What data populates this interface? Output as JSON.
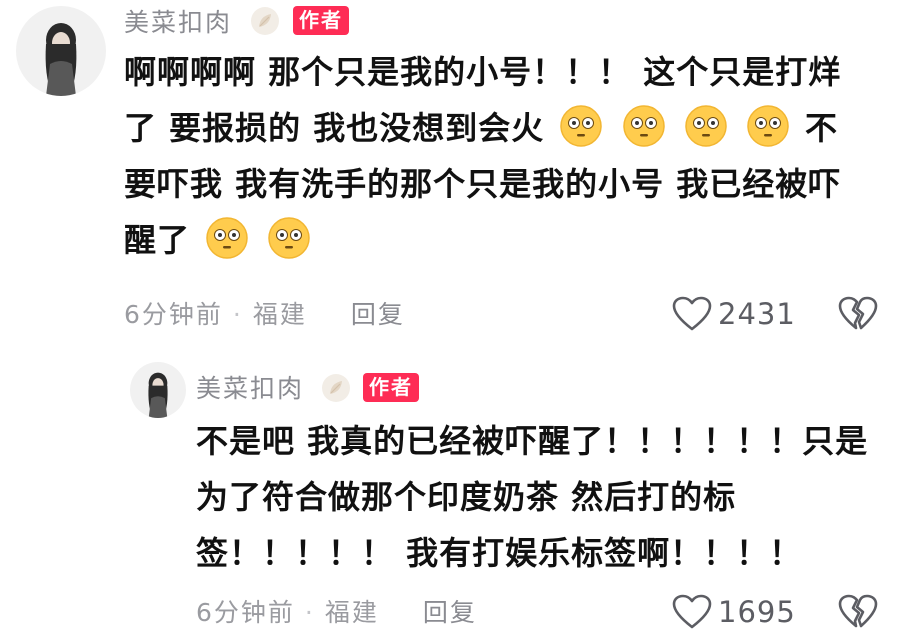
{
  "comments": [
    {
      "username": "美菜扣肉",
      "badge": "作者",
      "segments": [
        {
          "t": "text",
          "v": "啊啊啊啊 那个只是我的小号！！！ 这个只是打烊了 要报损的 我也没想到会火"
        },
        {
          "t": "emoji"
        },
        {
          "t": "emoji"
        },
        {
          "t": "emoji"
        },
        {
          "t": "emoji"
        },
        {
          "t": "text",
          "v": " 不要吓我 我有洗手的那个只是我的小号 我已经被吓醒了"
        },
        {
          "t": "emoji"
        },
        {
          "t": "emoji"
        }
      ],
      "time": "6分钟前",
      "location": "福建",
      "reply_label": "回复",
      "likes": "2431"
    },
    {
      "username": "美菜扣肉",
      "badge": "作者",
      "segments": [
        {
          "t": "text",
          "v": "不是吧 我真的已经被吓醒了！！！！！！只是为了符合做那个印度奶茶 然后打的标签！！！！！ 我有打娱乐标签啊！！！！"
        }
      ],
      "time": "6分钟前",
      "location": "福建",
      "reply_label": "回复",
      "likes": "1695"
    }
  ],
  "icons": {
    "emoji": "flushed-face-icon",
    "like": "heart-outline-icon",
    "dislike": "broken-heart-icon",
    "leaf": "leaf-icon"
  },
  "colors": {
    "badge_bg": "#fe2c55",
    "name": "#8a8b91",
    "meta": "#9a9ba0",
    "text": "#111111"
  }
}
